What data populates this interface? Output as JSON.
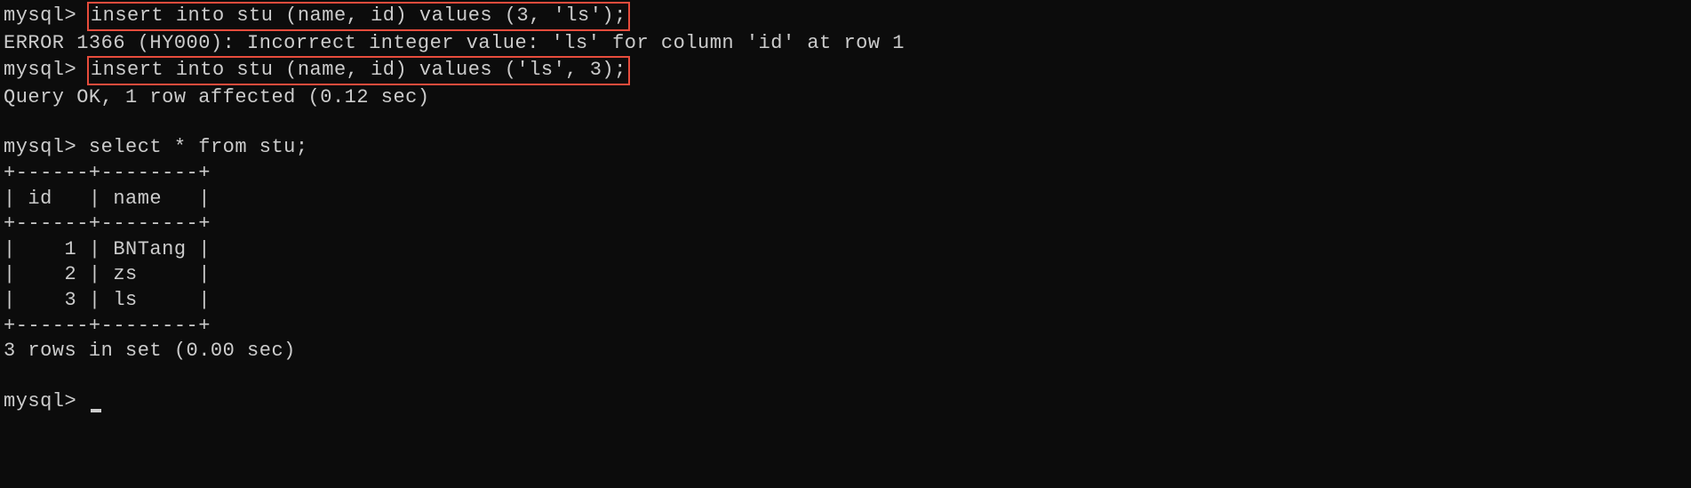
{
  "lines": {
    "prompt1": "mysql> ",
    "cmd1": "insert into stu (name, id) values (3, 'ls');",
    "error1": "ERROR 1366 (HY000): Incorrect integer value: 'ls' for column 'id' at row 1",
    "prompt2": "mysql> ",
    "cmd2": "insert into stu (name, id) values ('ls', 3);",
    "result1": "Query OK, 1 row affected (0.12 sec)",
    "blank1": "",
    "prompt3": "mysql> ",
    "cmd3": "select * from stu;",
    "table_border_top": "+------+--------+",
    "table_header": "| id   | name   |",
    "table_border_mid": "+------+--------+",
    "table_row1": "|    1 | BNTang |",
    "table_row2": "|    2 | zs     |",
    "table_row3": "|    3 | ls     |",
    "table_border_bot": "+------+--------+",
    "result2": "3 rows in set (0.00 sec)",
    "blank2": "",
    "prompt4": "mysql> "
  },
  "table_data": {
    "columns": [
      "id",
      "name"
    ],
    "rows": [
      {
        "id": 1,
        "name": "BNTang"
      },
      {
        "id": 2,
        "name": "zs"
      },
      {
        "id": 3,
        "name": "ls"
      }
    ]
  }
}
